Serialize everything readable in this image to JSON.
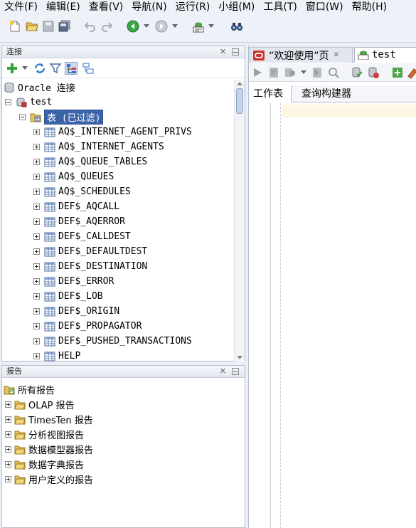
{
  "menu": [
    "文件(F)",
    "编辑(E)",
    "查看(V)",
    "导航(N)",
    "运行(R)",
    "小组(M)",
    "工具(T)",
    "窗口(W)",
    "帮助(H)"
  ],
  "connections_panel": {
    "title": "连接",
    "close": "✕",
    "tree": {
      "root": "Oracle 连接",
      "connection": "test",
      "tables_node": "表 (已过滤)",
      "tables": [
        "AQ$_INTERNET_AGENT_PRIVS",
        "AQ$_INTERNET_AGENTS",
        "AQ$_QUEUE_TABLES",
        "AQ$_QUEUES",
        "AQ$_SCHEDULES",
        "DEF$_AQCALL",
        "DEF$_AQERROR",
        "DEF$_CALLDEST",
        "DEF$_DEFAULTDEST",
        "DEF$_DESTINATION",
        "DEF$_ERROR",
        "DEF$_LOB",
        "DEF$_ORIGIN",
        "DEF$_PROPAGATOR",
        "DEF$_PUSHED_TRANSACTIONS",
        "HELP"
      ]
    }
  },
  "reports_panel": {
    "title": "报告",
    "close": "✕",
    "root": "所有报告",
    "items": [
      "OLAP 报告",
      "TimesTen 报告",
      "分析视图报告",
      "数据模型器报告",
      "数据字典报告",
      "用户定义的报告"
    ]
  },
  "editor": {
    "tabs": [
      {
        "label": "“欢迎使用”页",
        "close": "✕"
      },
      {
        "label": "test"
      }
    ],
    "sub_tabs": [
      "工作表",
      "查询构建器"
    ]
  },
  "colors": {
    "selection": "#3c62a8",
    "folder": "#e8c25a",
    "oracle_red": "#d0302a",
    "current_line": "#fdf6e2"
  }
}
